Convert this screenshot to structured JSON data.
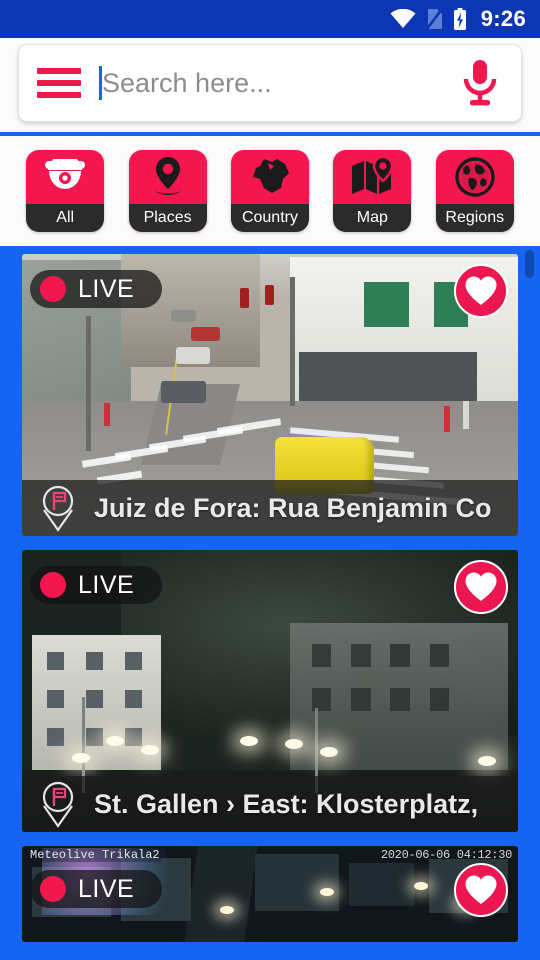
{
  "status_bar": {
    "time": "9:26",
    "icons": [
      "wifi-icon",
      "sim-off-icon",
      "battery-charging-icon"
    ]
  },
  "search": {
    "placeholder": "Search here...",
    "value": "",
    "menu_icon": "hamburger-menu-icon",
    "voice_icon": "microphone-icon"
  },
  "categories": [
    {
      "label": "All",
      "icon": "dome-camera-icon"
    },
    {
      "label": "Places",
      "icon": "map-pin-icon"
    },
    {
      "label": "Country",
      "icon": "country-shape-icon"
    },
    {
      "label": "Map",
      "icon": "folded-map-pin-icon"
    },
    {
      "label": "Regions",
      "icon": "globe-icon"
    }
  ],
  "feed": {
    "cards": [
      {
        "title": "Juiz de Fora: Rua Benjamin Co",
        "live_label": "LIVE",
        "favorite_icon": "heart-icon",
        "pin_icon": "flag-pin-icon",
        "osd_left": "",
        "osd_right": ""
      },
      {
        "title": "St. Gallen › East: Klosterplatz, ",
        "live_label": "LIVE",
        "favorite_icon": "heart-icon",
        "pin_icon": "flag-pin-icon",
        "osd_left": "",
        "osd_right": ""
      },
      {
        "title": "",
        "live_label": "LIVE",
        "favorite_icon": "heart-icon",
        "pin_icon": "flag-pin-icon",
        "osd_left": "Meteolive Trikala2",
        "osd_right": "2020-06-06 04:12:30"
      }
    ]
  },
  "colors": {
    "status_bar": "#0d36b5",
    "background": "#1565f0",
    "accent_pink": "#f4174f",
    "accent_crimson": "#ec1750",
    "tile_label": "#2b2b2b",
    "strip_background": "#fbfbfb"
  }
}
